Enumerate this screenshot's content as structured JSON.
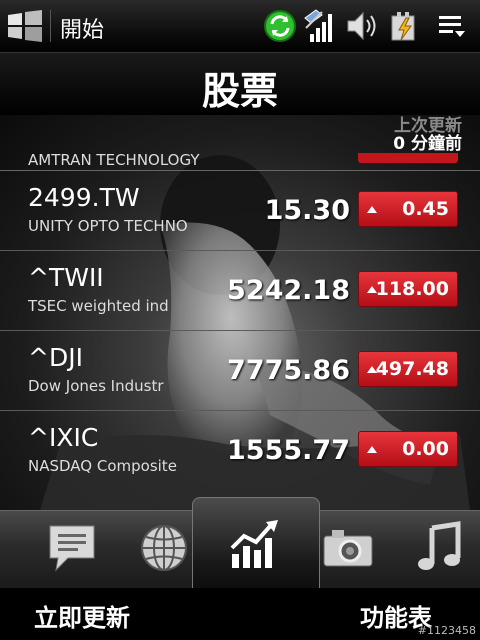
{
  "status_bar": {
    "start_label": "開始",
    "icons": [
      "windows-logo-icon",
      "sync-icon",
      "signal-icon",
      "speaker-icon",
      "battery-icon",
      "menu-icon"
    ]
  },
  "header": {
    "title": "股票",
    "last_update_line1": "上次更新",
    "last_update_line2": "0 分鐘前"
  },
  "stocks": {
    "partial_top_name": "AMTRAN TECHNOLOGY",
    "rows": [
      {
        "symbol": "2499.TW",
        "name": "UNITY OPTO TECHNO",
        "price": "15.30",
        "change": "0.45"
      },
      {
        "symbol": "^TWII",
        "name": "TSEC weighted ind",
        "price": "5242.18",
        "change": "118.00"
      },
      {
        "symbol": "^DJI",
        "name": "Dow Jones Industr",
        "price": "7775.86",
        "change": "497.48"
      },
      {
        "symbol": "^IXIC",
        "name": "NASDAQ Composite",
        "price": "1555.77",
        "change": "0.00"
      }
    ]
  },
  "tabs": [
    "message-icon",
    "globe-icon",
    "stocks-chart-icon",
    "camera-icon",
    "music-icon"
  ],
  "softkeys": {
    "left": "立即更新",
    "right": "功能表"
  },
  "watermark": "#1123458",
  "colors": {
    "change_badge": "#c4141c",
    "sync_icon": "#2fbf2f"
  }
}
